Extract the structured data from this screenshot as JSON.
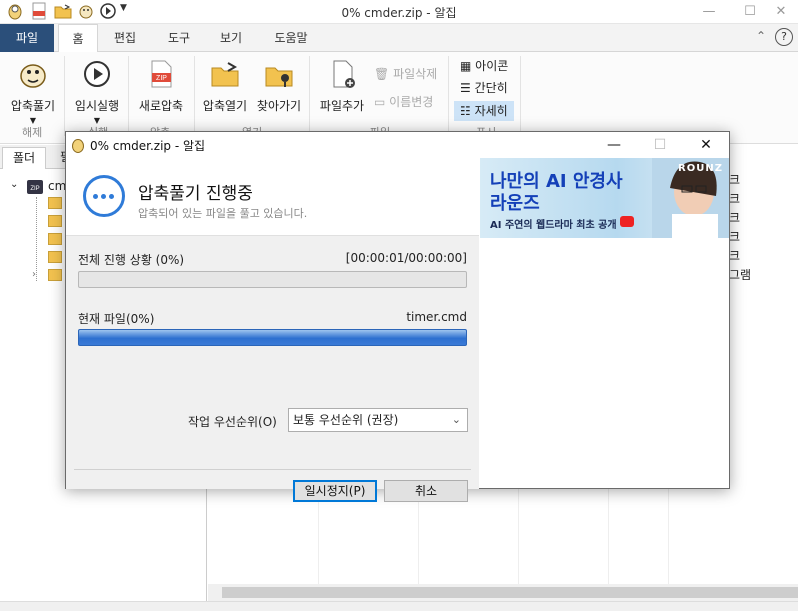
{
  "window": {
    "title": "0% cmder.zip - 알집",
    "minimize": "—",
    "maximize": "☐",
    "close": "✕"
  },
  "tabs": {
    "file": "파일",
    "items": [
      "홈",
      "편집",
      "도구",
      "보기",
      "도움말"
    ],
    "collapse": "⌃",
    "help": "?"
  },
  "ribbon": {
    "extract": "압축풀기",
    "extract_group": "해제",
    "run": "임시실행",
    "run_group": "실행",
    "new_zip": "새로압축",
    "new_zip_group": "압축",
    "open_zip": "압축열기",
    "find": "찾아가기",
    "open_group": "열기",
    "add_file": "파일추가",
    "delete_file": "파일삭제",
    "rename": "이름변경",
    "file_group": "파일",
    "view_icon": "아이콘",
    "view_simple": "간단히",
    "view_detail": "자세히",
    "view_group": "표시"
  },
  "left": {
    "tab_folder": "폴더",
    "tab_other": "필",
    "root": "cm"
  },
  "background_items": [
    "크",
    "크",
    "크",
    "크",
    "크",
    "그램"
  ],
  "dialog": {
    "title": "0% cmder.zip - 알집",
    "heading": "압축풀기 진행중",
    "subheading": "압축되어 있는 파일을 풀고 있습니다.",
    "total_label": "전체 진행 상황 (0%)",
    "total_time": "[00:00:01/00:00:00]",
    "total_progress": 0.0,
    "current_label": "현재 파일(0%)",
    "current_file": "timer.cmd",
    "current_progress": 1.0,
    "priority_label": "작업 우선순위(O)",
    "priority_value": "보통 우선순위 (권장)",
    "pause_button": "일시정지(P)",
    "cancel_button": "취소"
  },
  "ad": {
    "line1": "나만의 AI 안경사",
    "line2": "라운즈",
    "line3": "AI 주연의 웹드라마 최초 공개",
    "brand": "ROUNZ"
  }
}
